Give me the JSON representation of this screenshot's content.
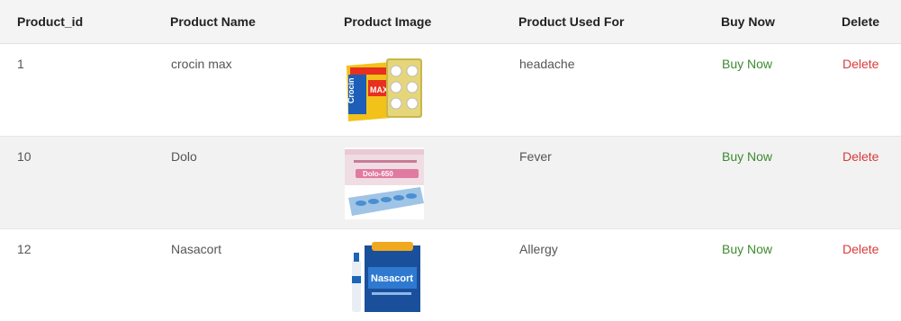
{
  "table": {
    "headers": [
      "Product_id",
      "Product Name",
      "Product Image",
      "Product Used For",
      "Buy Now",
      "Delete"
    ],
    "rows": [
      {
        "id": "1",
        "name": "crocin max",
        "image": "crocin-max-box",
        "used_for": "headache",
        "buy": "Buy Now",
        "delete": "Delete"
      },
      {
        "id": "10",
        "name": "Dolo",
        "image": "dolo-650-strip",
        "used_for": "Fever",
        "buy": "Buy Now",
        "delete": "Delete"
      },
      {
        "id": "12",
        "name": "Nasacort",
        "image": "nasacort-spray-box",
        "used_for": "Allergy",
        "buy": "Buy Now",
        "delete": "Delete"
      }
    ]
  },
  "colors": {
    "buy_link": "#3d8b2f",
    "delete_link": "#d93a3a",
    "header_bg": "#f4f4f4",
    "alt_row_bg": "#f2f2f2"
  }
}
